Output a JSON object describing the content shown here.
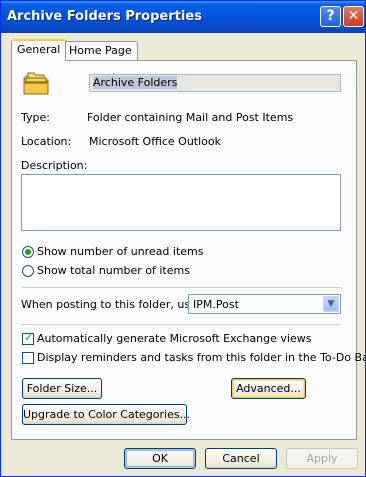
{
  "window": {
    "title": "Archive Folders Properties",
    "help_label": "?",
    "close_label": "✕"
  },
  "tabs": [
    {
      "label": "General",
      "active": true
    },
    {
      "label": "Home Page",
      "active": false
    }
  ],
  "general": {
    "folder_name": "Archive Folders",
    "type_label": "Type:",
    "type_value": "Folder containing Mail and Post Items",
    "location_label": "Location:",
    "location_value": "Microsoft Office Outlook",
    "description_label": "Description:",
    "description_value": "",
    "radio_unread": {
      "label": "Show number of unread items",
      "selected": true
    },
    "radio_total": {
      "label": "Show total number of items",
      "selected": false
    },
    "posting_label": "When posting to this folder, use:",
    "posting_value": "IPM.Post",
    "check_exchange": {
      "label": "Automatically generate Microsoft Exchange views",
      "checked": true
    },
    "check_reminders": {
      "label": "Display reminders and tasks from this folder in the To-Do Bar",
      "checked": false
    },
    "folder_size_button": "Folder Size...",
    "advanced_button": "Advanced...",
    "color_categories_button": "Upgrade to Color Categories..."
  },
  "footer": {
    "ok": "OK",
    "cancel": "Cancel",
    "apply": "Apply"
  },
  "colors": {
    "titlebar": "#0054e3",
    "dialog_bg": "#ece9d8",
    "panel_bg": "#fcfcfe",
    "tab_highlight": "#ffc83c",
    "check_green": "#21a121"
  }
}
